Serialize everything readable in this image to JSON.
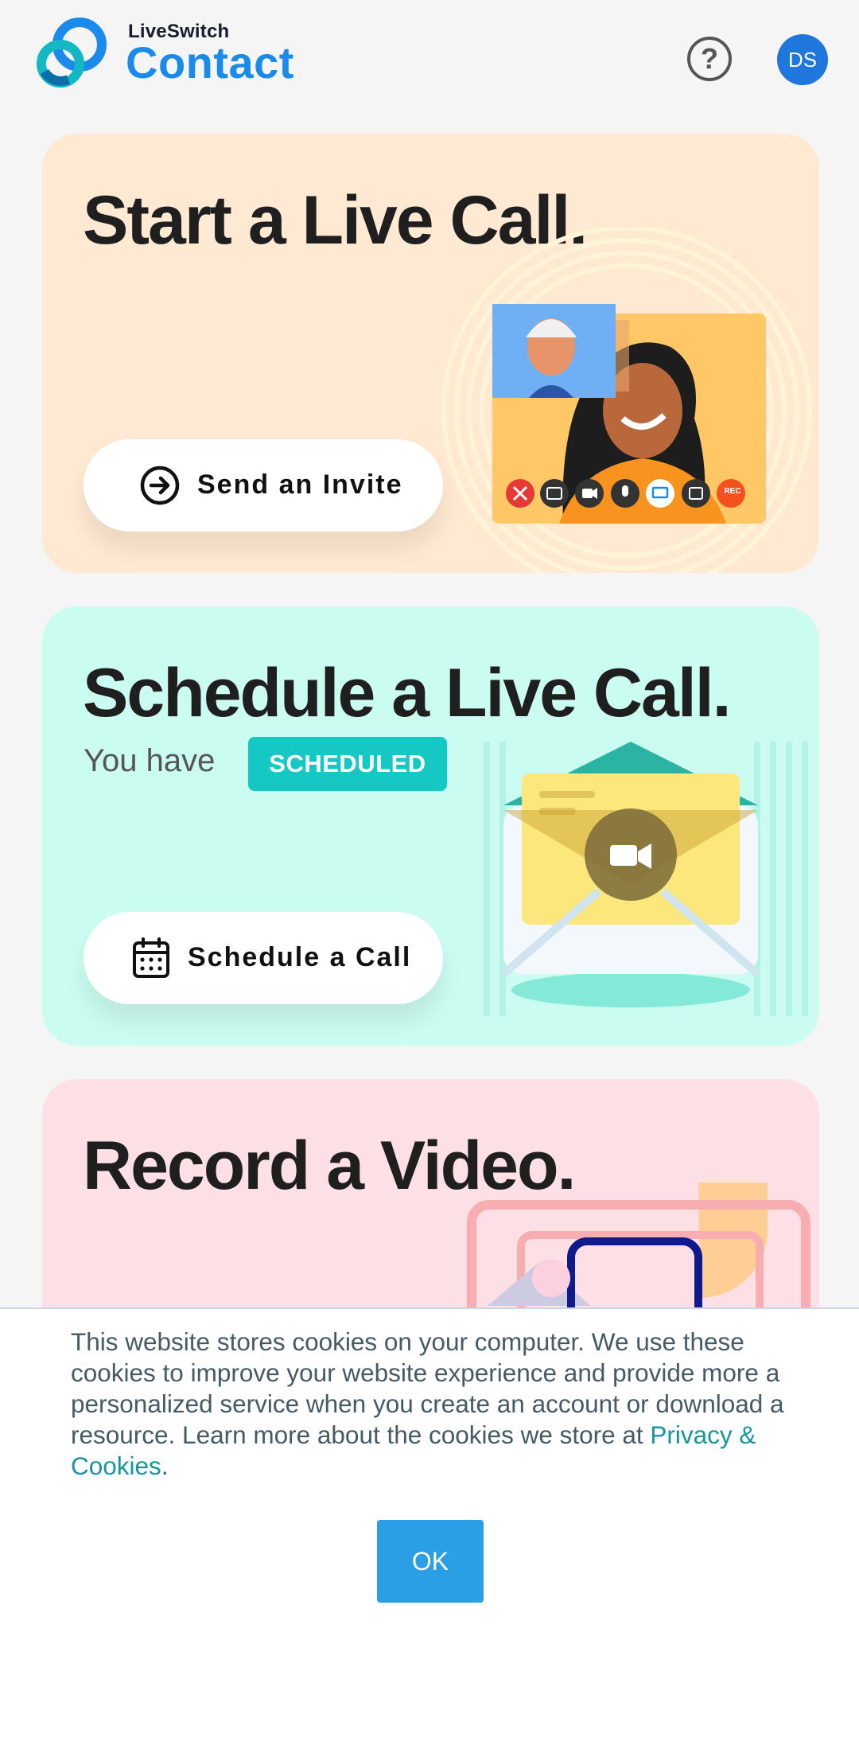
{
  "header": {
    "brand_top": "LiveSwitch",
    "brand_name": "Contact",
    "help_glyph": "?",
    "avatar_initials": "DS",
    "accent_color": "#1a8bea"
  },
  "cards": {
    "live": {
      "title": "Start a Live Call.",
      "button_label": "Send an Invite",
      "button_icon": "arrow-right-circle-icon",
      "rec_label": "REC",
      "background": "#ffe9d2"
    },
    "schedule": {
      "title": "Schedule a Live Call.",
      "you_have": "You have",
      "badge": "SCHEDULED",
      "button_label": "Schedule a Call",
      "button_icon": "calendar-icon",
      "background": "#cbfcf1"
    },
    "record": {
      "title": "Record a Video.",
      "background": "#fde0e5"
    }
  },
  "cookie_banner": {
    "text": "This website stores cookies on your computer. We use these cookies to improve your website experience and provide more a personalized service when you create an account or download a resource. Learn more about the cookies we store at ",
    "link_text": "Privacy & Cookies",
    "end_text": ".",
    "ok_label": "OK"
  }
}
